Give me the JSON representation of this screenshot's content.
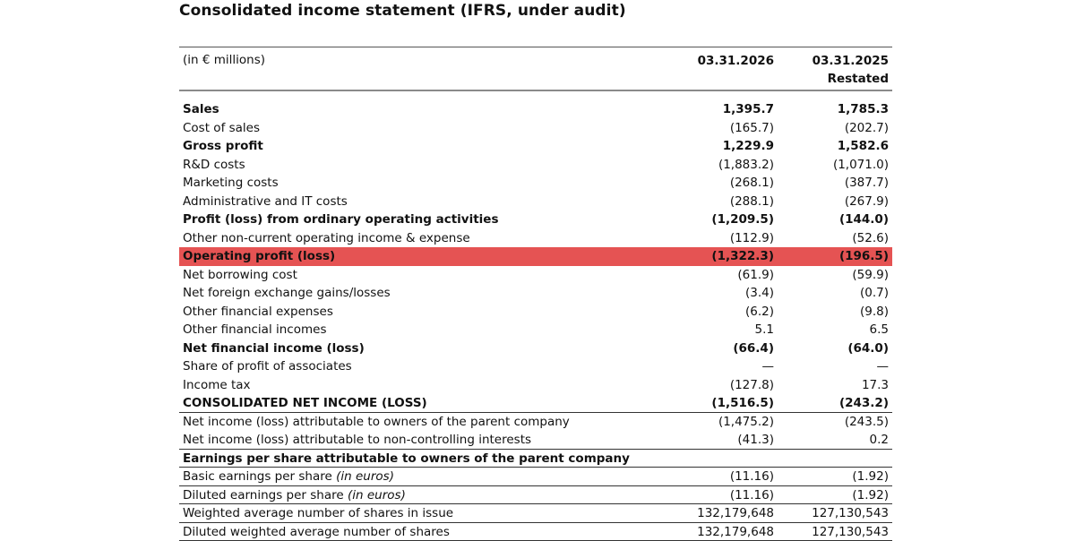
{
  "title": "Consolidated income statement (IFRS, under audit)",
  "header": {
    "unit": "(in € millions)",
    "col1": "03.31.2026",
    "col2_line1": "03.31.2025",
    "col2_line2": "Restated"
  },
  "rows": [
    {
      "label": "Sales",
      "v1": "1,395.7",
      "v2": "1,785.3",
      "bold": true
    },
    {
      "label": "Cost of sales",
      "v1": "(165.7)",
      "v2": "(202.7)"
    },
    {
      "label": "Gross profit",
      "v1": "1,229.9",
      "v2": "1,582.6",
      "bold": true
    },
    {
      "label": "R&D costs",
      "v1": "(1,883.2)",
      "v2": "(1,071.0)"
    },
    {
      "label": "Marketing costs",
      "v1": "(268.1)",
      "v2": "(387.7)"
    },
    {
      "label": "Administrative and IT costs",
      "v1": "(288.1)",
      "v2": "(267.9)"
    },
    {
      "label": "Profit (loss) from ordinary operating activities",
      "v1": "(1,209.5)",
      "v2": "(144.0)",
      "bold": true
    },
    {
      "label": "Other non-current operating income & expense",
      "v1": "(112.9)",
      "v2": "(52.6)"
    },
    {
      "label": "Operating profit (loss)",
      "v1": "(1,322.3)",
      "v2": "(196.5)",
      "bold": true,
      "highlight": true
    },
    {
      "label": "Net borrowing cost",
      "v1": "(61.9)",
      "v2": "(59.9)"
    },
    {
      "label": "Net foreign exchange gains/losses",
      "v1": "(3.4)",
      "v2": "(0.7)"
    },
    {
      "label": "Other financial expenses",
      "v1": "(6.2)",
      "v2": "(9.8)"
    },
    {
      "label": "Other financial incomes",
      "v1": "5.1",
      "v2": "6.5"
    },
    {
      "label": "Net financial income (loss)",
      "v1": "(66.4)",
      "v2": "(64.0)",
      "bold": true
    },
    {
      "label": "Share of profit of associates",
      "v1": "—",
      "v2": "—"
    },
    {
      "label": "Income tax",
      "v1": "(127.8)",
      "v2": "17.3"
    },
    {
      "label": "CONSOLIDATED NET INCOME (LOSS)",
      "v1": "(1,516.5)",
      "v2": "(243.2)",
      "bold": true,
      "rule": true
    },
    {
      "label": "Net income (loss) attributable to owners of the parent company",
      "v1": "(1,475.2)",
      "v2": "(243.5)"
    },
    {
      "label": "Net income (loss) attributable to non-controlling interests",
      "v1": "(41.3)",
      "v2": "0.2",
      "rule": true
    },
    {
      "label": "Earnings per share attributable to owners of the parent company",
      "v1": "",
      "v2": "",
      "bold": true,
      "rule": true
    },
    {
      "label": "Basic earnings per share",
      "label_italic": "(in euros)",
      "v1": "(11.16)",
      "v2": "(1.92)",
      "rule": true
    },
    {
      "label": "Diluted earnings per share",
      "label_italic": "(in euros)",
      "v1": "(11.16)",
      "v2": "(1.92)",
      "rule": true
    },
    {
      "label": "Weighted average number of shares in issue",
      "v1": "132,179,648",
      "v2": "127,130,543",
      "rule": true
    },
    {
      "label": "Diluted weighted average number of shares",
      "v1": "132,179,648",
      "v2": "127,130,543",
      "rule": true
    }
  ]
}
